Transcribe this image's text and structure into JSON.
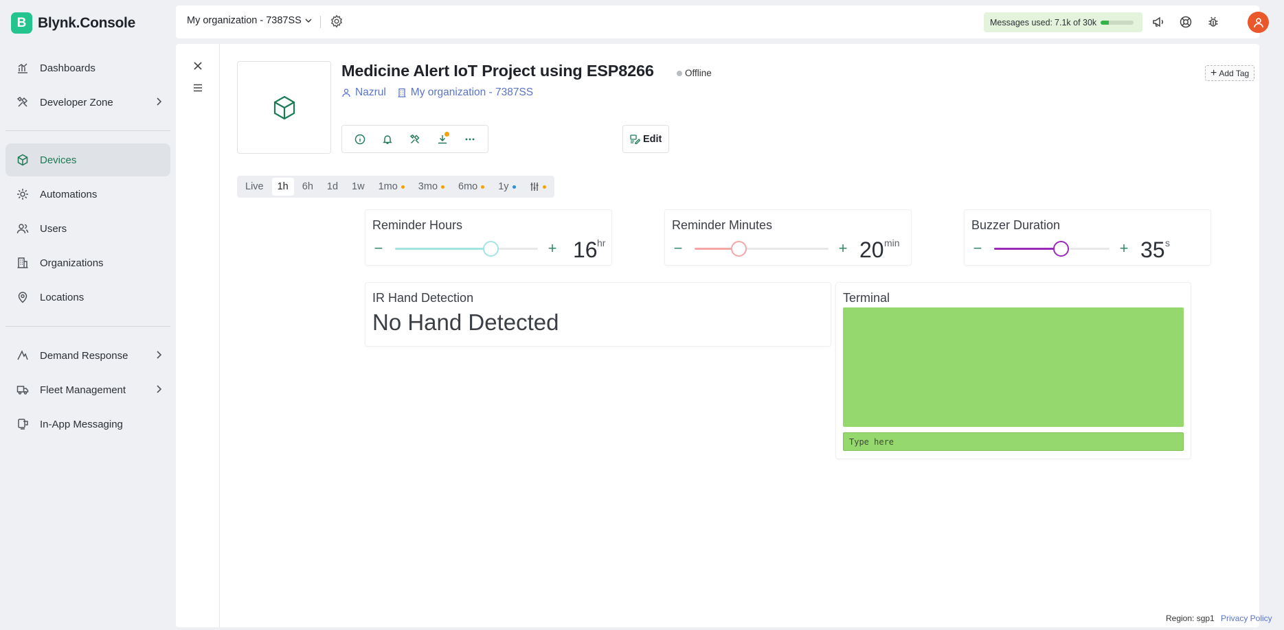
{
  "app": {
    "logo_letter": "B",
    "name": "Blynk.Console"
  },
  "sidebar": {
    "items": [
      {
        "label": "Dashboards",
        "icon": "bar-chart-icon",
        "active": false,
        "has_submenu": false
      },
      {
        "label": "Developer Zone",
        "icon": "tools-icon",
        "active": false,
        "has_submenu": true
      },
      {
        "label": "Devices",
        "icon": "cube-icon",
        "active": true,
        "has_submenu": false
      },
      {
        "label": "Automations",
        "icon": "automation-icon",
        "active": false,
        "has_submenu": false
      },
      {
        "label": "Users",
        "icon": "users-icon",
        "active": false,
        "has_submenu": false
      },
      {
        "label": "Organizations",
        "icon": "building-icon",
        "active": false,
        "has_submenu": false
      },
      {
        "label": "Locations",
        "icon": "location-pin-icon",
        "active": false,
        "has_submenu": false
      },
      {
        "label": "Demand Response",
        "icon": "demand-response-icon",
        "active": false,
        "has_submenu": true
      },
      {
        "label": "Fleet Management",
        "icon": "truck-icon",
        "active": false,
        "has_submenu": true
      },
      {
        "label": "In-App Messaging",
        "icon": "messaging-icon",
        "active": false,
        "has_submenu": false
      }
    ]
  },
  "topbar": {
    "org_name": "My organization - 7387SS",
    "messages": {
      "label": "Messages used:",
      "value": "7.1k of 30k",
      "fraction": 0.24
    }
  },
  "device": {
    "title": "Medicine Alert IoT Project using ESP8266",
    "status": "Offline",
    "owner": "Nazrul",
    "organization": "My organization - 7387SS",
    "edit_label": "Edit",
    "add_tag_label": "Add Tag"
  },
  "time_range": {
    "options": [
      {
        "label": "Live",
        "active": false,
        "dot": null
      },
      {
        "label": "1h",
        "active": true,
        "dot": null
      },
      {
        "label": "6h",
        "active": false,
        "dot": null
      },
      {
        "label": "1d",
        "active": false,
        "dot": null
      },
      {
        "label": "1w",
        "active": false,
        "dot": null
      },
      {
        "label": "1mo",
        "active": false,
        "dot": "#f0a30a"
      },
      {
        "label": "3mo",
        "active": false,
        "dot": "#f0a30a"
      },
      {
        "label": "6mo",
        "active": false,
        "dot": "#f0a30a"
      },
      {
        "label": "1y",
        "active": false,
        "dot": "#2c8fe0"
      }
    ]
  },
  "widgets": {
    "reminder_hours": {
      "title": "Reminder Hours",
      "value": "16",
      "unit": "hr",
      "fraction": 0.67,
      "color": "#a6e4e4"
    },
    "reminder_minutes": {
      "title": "Reminder Minutes",
      "value": "20",
      "unit": "min",
      "fraction": 0.33,
      "color": "#f5a6a6"
    },
    "buzzer_duration": {
      "title": "Buzzer Duration",
      "value": "35",
      "unit": "s",
      "fraction": 0.58,
      "color": "#9a2ab8"
    },
    "ir_hand": {
      "title": "IR Hand Detection",
      "value": "No Hand Detected"
    },
    "terminal": {
      "title": "Terminal",
      "placeholder": "Type here"
    }
  },
  "footer": {
    "region": "Region: sgp1",
    "privacy": "Privacy Policy"
  },
  "colors": {
    "brand": "#23c48e",
    "accent": "#1b7a53",
    "link": "#5a74c8",
    "terminal_bg": "#95d96e"
  }
}
